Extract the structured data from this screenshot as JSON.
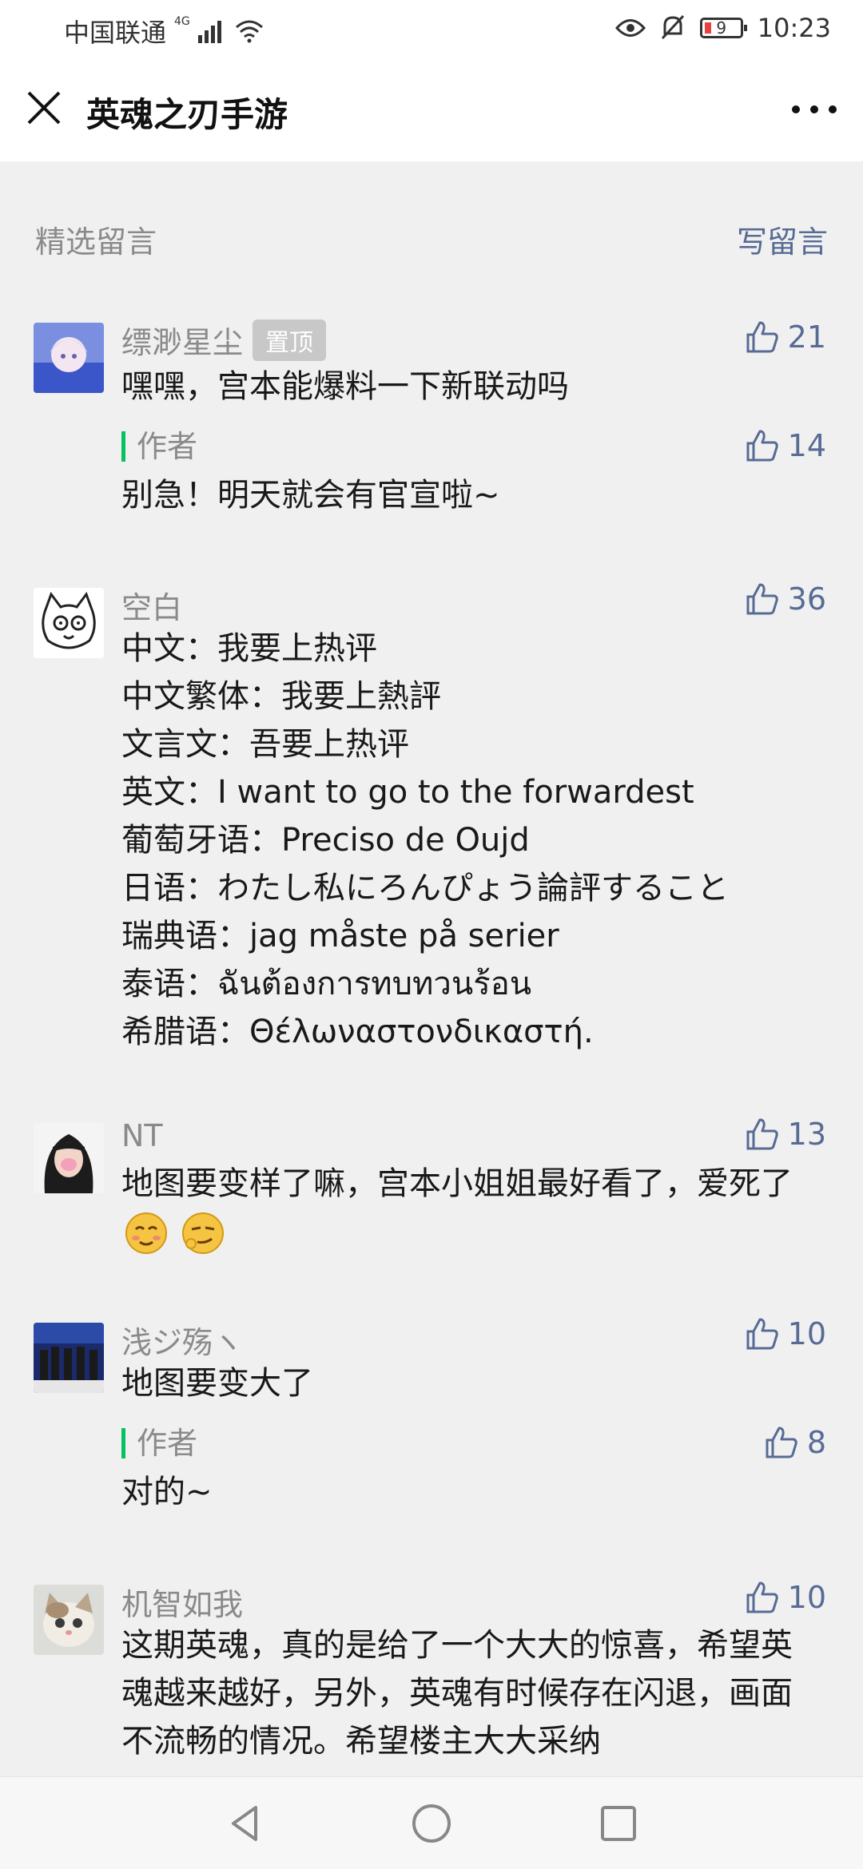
{
  "status": {
    "carrier": "中国联通",
    "network": "4G",
    "battery": "9",
    "time": "10:23"
  },
  "titlebar": {
    "title": "英魂之刃手游"
  },
  "section": {
    "title": "精选留言",
    "write_label": "写留言"
  },
  "comments": [
    {
      "nickname": "缥渺星尘",
      "pinned_label": "置顶",
      "text": "嘿嘿，宫本能爆料一下新联动吗",
      "likes": "21",
      "reply": {
        "author_label": "作者",
        "text": "别急！明天就会有官宣啦~",
        "likes": "14"
      }
    },
    {
      "nickname": "空白",
      "likes": "36",
      "lines": [
        "中文：我要上热评",
        "中文繁体：我要上熱評",
        "文言文：吾要上热评",
        "英文：I want to go to the forwardest",
        "葡萄牙语：Preciso de Oujd",
        "日语：わたし私にろんぴょう論評すること",
        "瑞典语：jag måste på serier",
        "泰语：ฉันต้องการทบทวนร้อน",
        "希腊语：Θέλωναστονδικαστή."
      ]
    },
    {
      "nickname": "NT",
      "likes": "13",
      "text": "地图要变样了嘛，宫本小姐姐最好看了，爱死了",
      "emojis": [
        "blush-emoji",
        "smirk-emoji"
      ]
    },
    {
      "nickname": "浅ジ殇ヽ",
      "likes": "10",
      "text": "地图要变大了",
      "reply": {
        "author_label": "作者",
        "text": "对的~",
        "likes": "8"
      }
    },
    {
      "nickname": "机智如我",
      "likes": "10",
      "text": "这期英魂，真的是给了一个大大的惊喜，希望英魂越来越好，另外，英魂有时候存在闪退，画面不流畅的情况。希望楼主大大采纳"
    }
  ],
  "colors": {
    "link": "#576b95",
    "author_bar": "#07c160",
    "background": "#f0f0f0"
  },
  "icons": {
    "close": "close-icon",
    "more": "more-dots-icon",
    "like": "thumbs-up-icon",
    "nav_back": "triangle-back-icon",
    "nav_home": "circle-home-icon",
    "nav_recent": "square-recent-icon"
  }
}
